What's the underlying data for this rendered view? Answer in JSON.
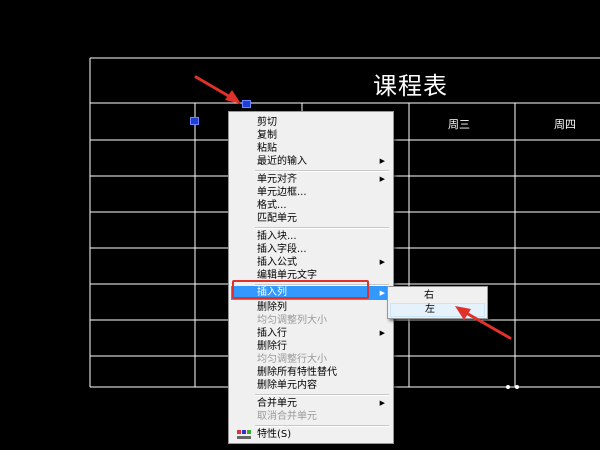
{
  "table": {
    "title": "课程表",
    "headers": [
      "周三",
      "周四"
    ]
  },
  "context_menu": {
    "items": [
      {
        "label": "剪切",
        "disabled": false,
        "submenu": false
      },
      {
        "label": "复制",
        "disabled": false,
        "submenu": false
      },
      {
        "label": "粘贴",
        "disabled": false,
        "submenu": false
      },
      {
        "label": "最近的输入",
        "disabled": false,
        "submenu": true
      },
      {
        "label": "单元对齐",
        "disabled": false,
        "submenu": true
      },
      {
        "label": "单元边框...",
        "disabled": false,
        "submenu": false
      },
      {
        "label": "格式...",
        "disabled": false,
        "submenu": false
      },
      {
        "label": "匹配单元",
        "disabled": false,
        "submenu": false
      },
      {
        "label": "插入块...",
        "disabled": false,
        "submenu": false
      },
      {
        "label": "插入字段...",
        "disabled": false,
        "submenu": false
      },
      {
        "label": "插入公式",
        "disabled": false,
        "submenu": true
      },
      {
        "label": "编辑单元文字",
        "disabled": false,
        "submenu": false
      },
      {
        "label": "插入列",
        "disabled": false,
        "submenu": true,
        "highlighted": true
      },
      {
        "label": "删除列",
        "disabled": false,
        "submenu": false
      },
      {
        "label": "均匀调整列大小",
        "disabled": true,
        "submenu": false
      },
      {
        "label": "插入行",
        "disabled": false,
        "submenu": true
      },
      {
        "label": "删除行",
        "disabled": false,
        "submenu": false
      },
      {
        "label": "均匀调整行大小",
        "disabled": true,
        "submenu": false
      },
      {
        "label": "删除所有特性替代",
        "disabled": false,
        "submenu": false
      },
      {
        "label": "删除单元内容",
        "disabled": false,
        "submenu": false
      },
      {
        "label": "合并单元",
        "disabled": false,
        "submenu": true
      },
      {
        "label": "取消合并单元",
        "disabled": true,
        "submenu": false
      },
      {
        "label": "特性(S)",
        "disabled": false,
        "submenu": false
      }
    ],
    "submenu_arrow": "▶",
    "properties_icon": "properties-icon"
  },
  "submenu": {
    "items": [
      "右",
      "左"
    ],
    "hover_index": 1
  },
  "colors": {
    "background": "#000000",
    "grid_lines": "#ffffff",
    "grips": "#1f3fd9",
    "menu_bg": "#f0f0f0",
    "menu_highlight": "#3399ff",
    "annotation_red": "#e0312b"
  }
}
